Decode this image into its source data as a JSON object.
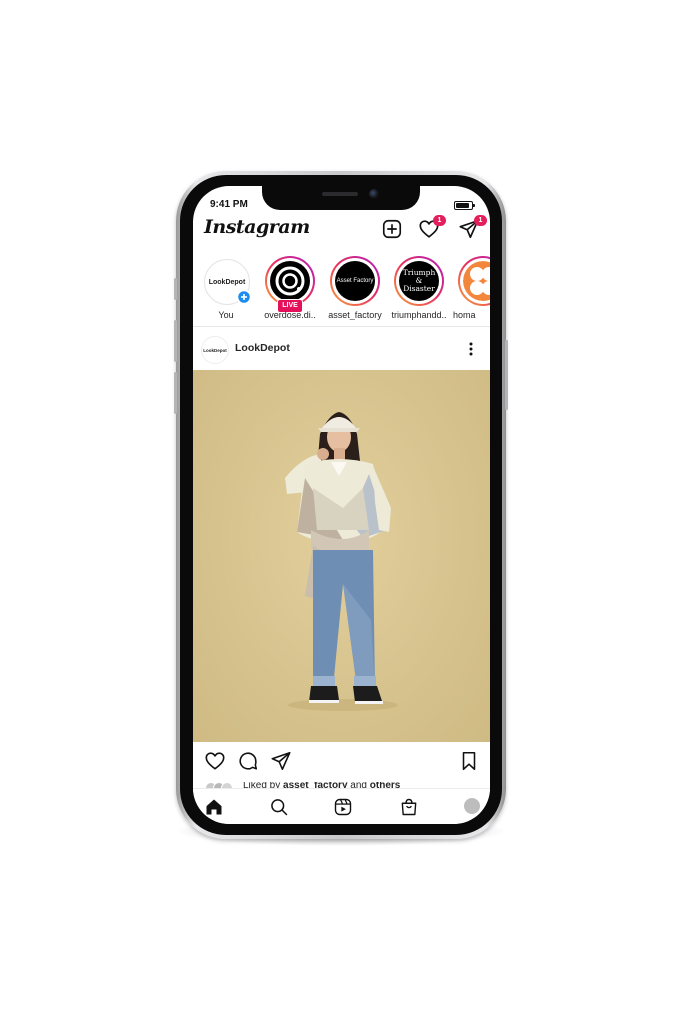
{
  "status_bar": {
    "time": "9:41 PM"
  },
  "header": {
    "logo": "Instagram",
    "activity_badge": "1",
    "messages_badge": "1"
  },
  "stories": [
    {
      "name": "You",
      "avatar_text": "LookDepot",
      "live": false
    },
    {
      "name": "overdose.di..",
      "avatar_text": "",
      "live": true,
      "live_label": "LIVE"
    },
    {
      "name": "asset_factory",
      "avatar_text": "Asset Factory",
      "live": false
    },
    {
      "name": "triumphandd..",
      "avatar_text": "Triumph & Disaster",
      "live": false
    },
    {
      "name": "homa",
      "avatar_text": "",
      "live": false
    }
  ],
  "post": {
    "avatar_text": "LookDepot",
    "username": "LookDepot",
    "liked_prefix": "Liked by ",
    "liked_user": "asset_factory",
    "liked_middle": " and ",
    "liked_suffix": "others"
  },
  "colors": {
    "accent_badge": "#e41e5a",
    "story_gradient": [
      "#f9a63a",
      "#e8305e",
      "#b01ec1"
    ],
    "photo_background": "#d7c38e"
  }
}
